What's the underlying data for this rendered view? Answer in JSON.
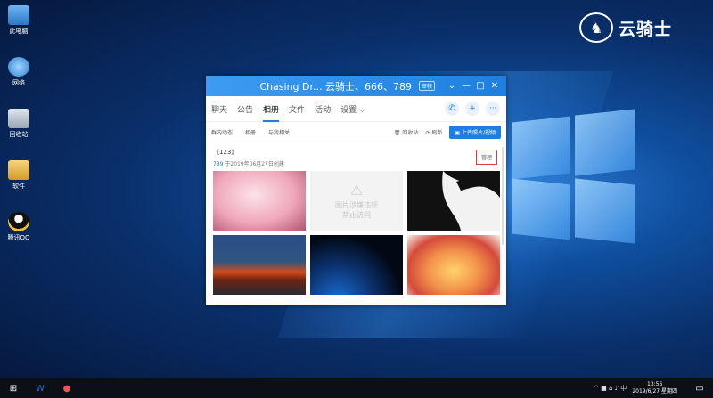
{
  "desktop": {
    "icons": [
      {
        "label": "此电脑"
      },
      {
        "label": "网络"
      },
      {
        "label": "回收站"
      },
      {
        "label": "软件"
      },
      {
        "label": "腾讯QQ"
      }
    ],
    "brand": "云骑士"
  },
  "window": {
    "title": "Chasing Dr...  云骑士、666、789",
    "tag": "审核",
    "controls": {
      "more": "⌄",
      "min": "—",
      "max": "□",
      "close": "✕"
    },
    "tabs": [
      {
        "label": "聊天"
      },
      {
        "label": "公告"
      },
      {
        "label": "相册"
      },
      {
        "label": "文件"
      },
      {
        "label": "活动"
      },
      {
        "label": "设置 ⌵"
      }
    ],
    "subtabs": [
      {
        "label": "群内动态"
      },
      {
        "label": "相册"
      },
      {
        "label": "与我相关"
      }
    ],
    "actions": {
      "recycle": "回收站",
      "refresh": "刷新",
      "upload": "上传照片/视频"
    },
    "album": {
      "title": "《123》",
      "owner": "789",
      "created": "于2019年06月27日创建",
      "manage_label": "管理"
    },
    "blocked_text": [
      "图片涉嫌违规",
      "禁止访问"
    ]
  },
  "taskbar": {
    "tray": "^ ■ ⌂ ♪ 中",
    "time": "13:56",
    "date": "2019/6/27 星期四"
  }
}
